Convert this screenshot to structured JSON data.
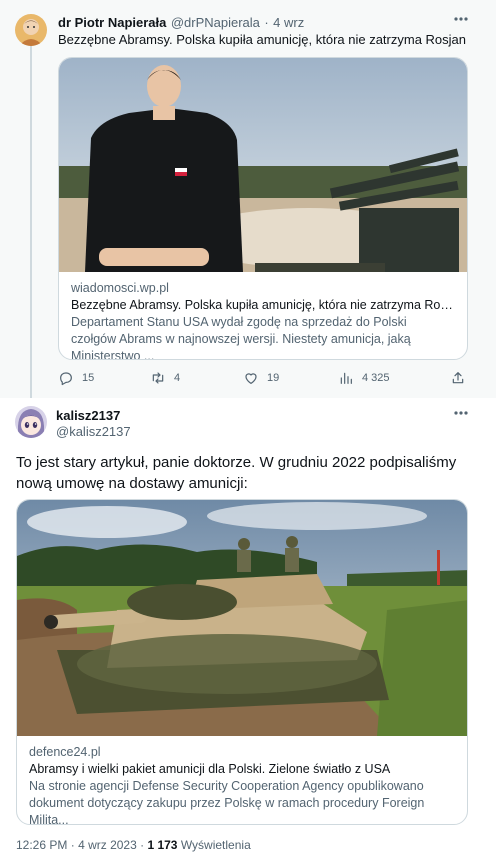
{
  "tweet1": {
    "author_name": "dr Piotr Napierała",
    "handle": "@drPNapierala",
    "separator": "·",
    "time": "4 wrz",
    "text": "Bezzębne Abramsy. Polska kupiła amunicję, która nie zatrzyma Rosjan",
    "card": {
      "domain": "wiadomosci.wp.pl",
      "title": "Bezzębne Abramsy. Polska kupiła amunicję, która nie zatrzyma Rosjan",
      "description": "Departament Stanu USA wydał zgodę na sprzedaż do Polski czołgów Abrams w najnowszej wersji. Niestety amunicja, jaką Ministerstwo ..."
    },
    "actions": {
      "replies": "15",
      "reposts": "4",
      "likes": "19",
      "views": "4 325"
    }
  },
  "tweet2": {
    "author_name": "kalisz2137",
    "handle": "@kalisz2137",
    "text": "To jest stary artykuł, panie doktorze. W grudniu 2022 podpisaliśmy nową umowę na dostawy amunicji:",
    "card": {
      "domain": "defence24.pl",
      "title": "Abramsy i wielki pakiet amunicji dla Polski. Zielone światło z USA",
      "description": "Na stronie agencji Defense Security Cooperation Agency opublikowano dokument dotyczący zakupu przez Polskę w ramach procedury Foreign Milita..."
    },
    "footer": {
      "time": "12:26 PM",
      "sep1": "·",
      "date": "4 wrz 2023",
      "sep2": "·",
      "views_count": "1 173",
      "views_label": "Wyświetlenia"
    }
  },
  "colors": {
    "text": "#0f1419",
    "muted": "#536471",
    "border": "#cfd9de",
    "thread_bg": "#f7f9f9"
  },
  "icons": [
    "more-icon",
    "reply-icon",
    "repost-icon",
    "like-icon",
    "views-icon",
    "share-icon"
  ]
}
